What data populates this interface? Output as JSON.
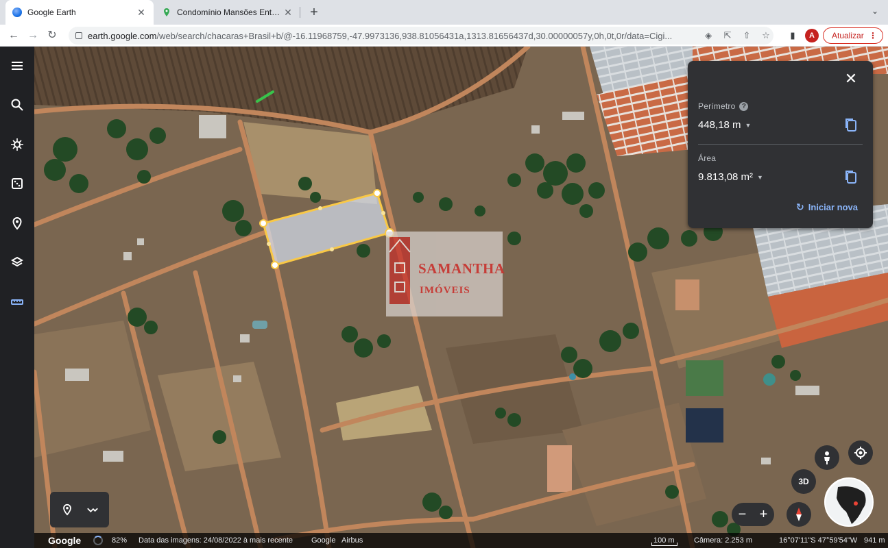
{
  "tabs": [
    {
      "title": "Google Earth",
      "active": true
    },
    {
      "title": "Condomínio Mansões Entrelagos",
      "active": false
    }
  ],
  "address": {
    "host": "earth.google.com",
    "path": "/web/search/chacaras+Brasil+b/@-16.11968759,-47.9973136,938.81056431a,1313.81656437d,30.00000057y,0h,0t,0r/data=Cigi..."
  },
  "profile_initial": "A",
  "update_label": "Atualizar",
  "measure": {
    "perimeter_label": "Perímetro",
    "perimeter_value": "448,18 m",
    "area_label": "Área",
    "area_value": "9.813,08 m²",
    "new_label": "Iniciar nova"
  },
  "watermark": {
    "line1": "SAMANTHA",
    "line2": "IMÓVEIS"
  },
  "controls": {
    "view_3d": "3D",
    "zoom_out": "−",
    "zoom_in": "+"
  },
  "status": {
    "logo": "Google",
    "load_pct": "82%",
    "imagery_date": "Data das imagens: 24/08/2022 à mais recente",
    "attribution": "Google   Airbus",
    "scale": "100 m",
    "camera": "Câmera: 2.253 m",
    "coords": "16°07'11\"S 47°59'54\"W",
    "elevation": "941 m"
  },
  "colors": {
    "rail": "#202124",
    "panel": "#303134",
    "accent": "#8ab4f8",
    "polygon": "#f9c846",
    "update": "#c5221f"
  }
}
